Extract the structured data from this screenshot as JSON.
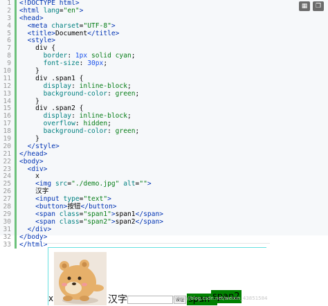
{
  "toolbar": {
    "items": [
      {
        "icon": "view-grid-icon"
      },
      {
        "icon": "copy-icon"
      }
    ]
  },
  "code_lines": [
    {
      "n": "1",
      "html": "<span class=\"k\">&lt;!DOCTYPE html&gt;</span>"
    },
    {
      "n": "2",
      "html": "<span class=\"k\">&lt;html</span> <span class=\"p\">lang</span>=<span class=\"s\">\"en\"</span><span class=\"k\">&gt;</span>"
    },
    {
      "n": "3",
      "html": "<span class=\"k\">&lt;head&gt;</span>"
    },
    {
      "n": "4",
      "html": "  <span class=\"k\">&lt;meta</span> <span class=\"p\">charset</span>=<span class=\"s\">\"UTF-8\"</span><span class=\"k\">&gt;</span>"
    },
    {
      "n": "5",
      "html": "  <span class=\"k\">&lt;title&gt;</span>Document<span class=\"k\">&lt;/title&gt;</span>"
    },
    {
      "n": "6",
      "html": "  <span class=\"k\">&lt;style&gt;</span>"
    },
    {
      "n": "7",
      "html": "    div {"
    },
    {
      "n": "8",
      "html": "      <span class=\"p\">border</span>: <span class=\"n\">1px</span> <span class=\"s\">solid</span> <span class=\"s\">cyan</span>;"
    },
    {
      "n": "9",
      "html": "      <span class=\"p\">font-size</span>: <span class=\"n\">30px</span>;"
    },
    {
      "n": "10",
      "html": "    }"
    },
    {
      "n": "11",
      "html": "    div .span1 {"
    },
    {
      "n": "12",
      "html": "      <span class=\"p\">display</span>: <span class=\"s\">inline-block</span>;"
    },
    {
      "n": "13",
      "html": "      <span class=\"p\">background-color</span>: <span class=\"s\">green</span>;"
    },
    {
      "n": "14",
      "html": "    }"
    },
    {
      "n": "15",
      "html": "    div .span2 {"
    },
    {
      "n": "16",
      "html": "      <span class=\"p\">display</span>: <span class=\"s\">inline-block</span>;"
    },
    {
      "n": "17",
      "html": "      <span class=\"p\">overflow</span>: <span class=\"s\">hidden</span>;"
    },
    {
      "n": "18",
      "html": "      <span class=\"p\">background-color</span>: <span class=\"s\">green</span>;"
    },
    {
      "n": "19",
      "html": "    }"
    },
    {
      "n": "20",
      "html": "  <span class=\"k\">&lt;/style&gt;</span>"
    },
    {
      "n": "21",
      "html": "<span class=\"k\">&lt;/head&gt;</span>"
    },
    {
      "n": "22",
      "html": "<span class=\"k\">&lt;body&gt;</span>"
    },
    {
      "n": "23",
      "html": "  <span class=\"k\">&lt;div&gt;</span>"
    },
    {
      "n": "24",
      "html": "    x"
    },
    {
      "n": "25",
      "html": "    <span class=\"k\">&lt;img</span> <span class=\"p\">src</span>=<span class=\"s\">\"./demo.jpg\"</span> <span class=\"p\">alt</span>=<span class=\"s\">\"\"</span><span class=\"k\">&gt;</span>"
    },
    {
      "n": "26",
      "html": "    汉字"
    },
    {
      "n": "27",
      "html": "    <span class=\"k\">&lt;input</span> <span class=\"p\">type</span>=<span class=\"s\">\"text\"</span><span class=\"k\">&gt;</span>"
    },
    {
      "n": "28",
      "html": "    <span class=\"k\">&lt;button&gt;</span>按钮<span class=\"k\">&lt;/button&gt;</span>"
    },
    {
      "n": "29",
      "html": "    <span class=\"k\">&lt;span</span> <span class=\"p\">class</span>=<span class=\"s\">\"span1\"</span><span class=\"k\">&gt;</span>span1<span class=\"k\">&lt;/span&gt;</span>"
    },
    {
      "n": "30",
      "html": "    <span class=\"k\">&lt;span</span> <span class=\"p\">class</span>=<span class=\"s\">\"span2\"</span><span class=\"k\">&gt;</span>span2<span class=\"k\">&lt;/span&gt;</span>"
    },
    {
      "n": "31",
      "html": "  <span class=\"k\">&lt;/div&gt;</span>"
    },
    {
      "n": "32",
      "html": "<span class=\"k\">&lt;/body&gt;</span>"
    },
    {
      "n": "33",
      "html": "<span class=\"k\">&lt;/html&gt;</span>"
    }
  ],
  "demo": {
    "x_text": "x",
    "hanzi": "汉字",
    "button_label": "按钮",
    "span1": "span1",
    "span2": "span2",
    "watermark": "https://blog.csdn.net/weixin_43851584"
  },
  "colors": {
    "border": "cyan",
    "span_bg": "green",
    "gutter": "#6cc17b"
  }
}
